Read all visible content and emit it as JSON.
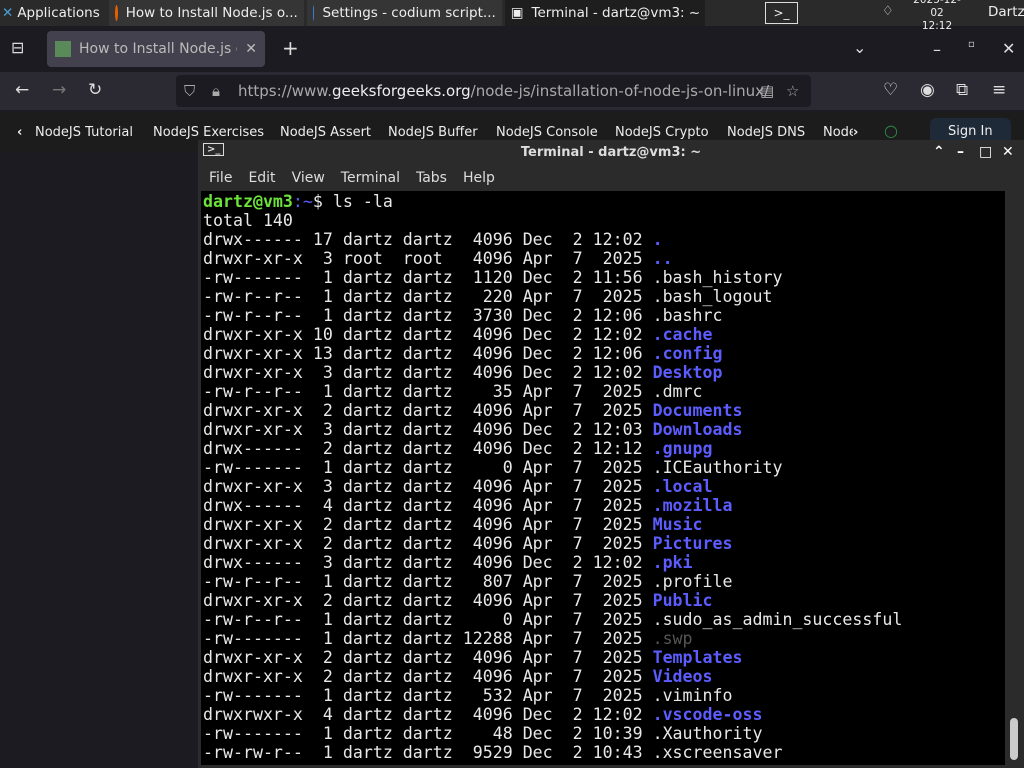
{
  "panel": {
    "apps_label": "Applications",
    "tasks": [
      "How to Install Node.js o...",
      "Settings - codium script...",
      "Terminal - dartz@vm3: ~"
    ],
    "date": "2025-12-02",
    "time": "12:12",
    "user": "Dartz"
  },
  "browser": {
    "tab_title": "How to Install Node.js or",
    "url_prefix": "https://www.",
    "url_domain": "geeksforgeeks.org",
    "url_path": "/node-js/installation-of-node-js-on-linux/",
    "bookmarks": [
      "NodeJS Tutorial",
      "NodeJS Exercises",
      "NodeJS Assert",
      "NodeJS Buffer",
      "NodeJS Console",
      "NodeJS Crypto",
      "NodeJS DNS",
      "Node"
    ],
    "sign_in": "Sign In"
  },
  "terminal": {
    "title": "Terminal - dartz@vm3: ~",
    "menu": [
      "File",
      "Edit",
      "View",
      "Terminal",
      "Tabs",
      "Help"
    ],
    "prompt_user": "dartz@vm3",
    "prompt_path": ":~",
    "prompt_symbol": "$ ",
    "command": "ls -la",
    "total": "total 140",
    "lines": [
      {
        "meta": "drwx------ 17 dartz dartz  4096 Dec  2 12:02 ",
        "name": ".",
        "kind": "dir"
      },
      {
        "meta": "drwxr-xr-x  3 root  root   4096 Apr  7  2025 ",
        "name": "..",
        "kind": "dir"
      },
      {
        "meta": "-rw-------  1 dartz dartz  1120 Dec  2 11:56 ",
        "name": ".bash_history",
        "kind": "file"
      },
      {
        "meta": "-rw-r--r--  1 dartz dartz   220 Apr  7  2025 ",
        "name": ".bash_logout",
        "kind": "file"
      },
      {
        "meta": "-rw-r--r--  1 dartz dartz  3730 Dec  2 12:06 ",
        "name": ".bashrc",
        "kind": "file"
      },
      {
        "meta": "drwxr-xr-x 10 dartz dartz  4096 Dec  2 12:02 ",
        "name": ".cache",
        "kind": "dir"
      },
      {
        "meta": "drwxr-xr-x 13 dartz dartz  4096 Dec  2 12:06 ",
        "name": ".config",
        "kind": "dir"
      },
      {
        "meta": "drwxr-xr-x  3 dartz dartz  4096 Dec  2 12:02 ",
        "name": "Desktop",
        "kind": "dir"
      },
      {
        "meta": "-rw-r--r--  1 dartz dartz    35 Apr  7  2025 ",
        "name": ".dmrc",
        "kind": "file"
      },
      {
        "meta": "drwxr-xr-x  2 dartz dartz  4096 Apr  7  2025 ",
        "name": "Documents",
        "kind": "dir"
      },
      {
        "meta": "drwxr-xr-x  3 dartz dartz  4096 Dec  2 12:03 ",
        "name": "Downloads",
        "kind": "dir"
      },
      {
        "meta": "drwx------  2 dartz dartz  4096 Dec  2 12:12 ",
        "name": ".gnupg",
        "kind": "dir"
      },
      {
        "meta": "-rw-------  1 dartz dartz     0 Apr  7  2025 ",
        "name": ".ICEauthority",
        "kind": "file"
      },
      {
        "meta": "drwxr-xr-x  3 dartz dartz  4096 Apr  7  2025 ",
        "name": ".local",
        "kind": "dir"
      },
      {
        "meta": "drwx------  4 dartz dartz  4096 Apr  7  2025 ",
        "name": ".mozilla",
        "kind": "dir"
      },
      {
        "meta": "drwxr-xr-x  2 dartz dartz  4096 Apr  7  2025 ",
        "name": "Music",
        "kind": "dir"
      },
      {
        "meta": "drwxr-xr-x  2 dartz dartz  4096 Apr  7  2025 ",
        "name": "Pictures",
        "kind": "dir"
      },
      {
        "meta": "drwx------  3 dartz dartz  4096 Dec  2 12:02 ",
        "name": ".pki",
        "kind": "dir"
      },
      {
        "meta": "-rw-r--r--  1 dartz dartz   807 Apr  7  2025 ",
        "name": ".profile",
        "kind": "file"
      },
      {
        "meta": "drwxr-xr-x  2 dartz dartz  4096 Apr  7  2025 ",
        "name": "Public",
        "kind": "dir"
      },
      {
        "meta": "-rw-r--r--  1 dartz dartz     0 Apr  7  2025 ",
        "name": ".sudo_as_admin_successful",
        "kind": "file"
      },
      {
        "meta": "-rw-------  1 dartz dartz 12288 Apr  7  2025 ",
        "name": ".swp",
        "kind": "dim"
      },
      {
        "meta": "drwxr-xr-x  2 dartz dartz  4096 Apr  7  2025 ",
        "name": "Templates",
        "kind": "dir"
      },
      {
        "meta": "drwxr-xr-x  2 dartz dartz  4096 Apr  7  2025 ",
        "name": "Videos",
        "kind": "dir"
      },
      {
        "meta": "-rw-------  1 dartz dartz   532 Apr  7  2025 ",
        "name": ".viminfo",
        "kind": "file"
      },
      {
        "meta": "drwxrwxr-x  4 dartz dartz  4096 Dec  2 12:02 ",
        "name": ".vscode-oss",
        "kind": "dir"
      },
      {
        "meta": "-rw-------  1 dartz dartz    48 Dec  2 10:39 ",
        "name": ".Xauthority",
        "kind": "file"
      },
      {
        "meta": "-rw-rw-r--  1 dartz dartz  9529 Dec  2 10:43 ",
        "name": ".xscreensaver",
        "kind": "file"
      }
    ]
  },
  "colors": {
    "directory": "#5c5cff",
    "prompt_user": "#6ce23a",
    "dim_file": "#555555"
  }
}
